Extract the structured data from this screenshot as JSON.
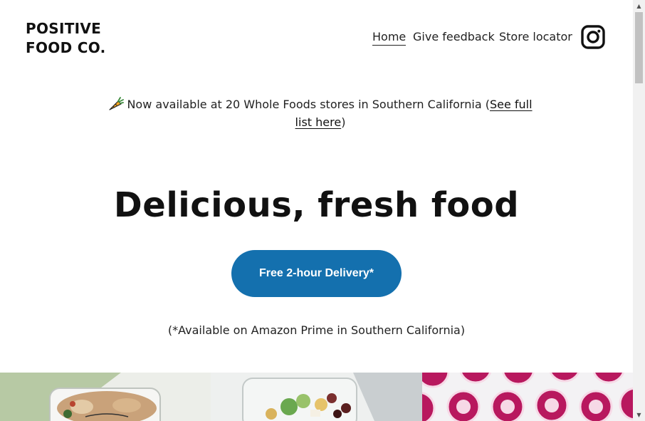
{
  "header": {
    "logo_line1": "POSITIVE",
    "logo_line2": "FOOD CO.",
    "nav": [
      {
        "label": "Home",
        "active": true
      },
      {
        "label": "Give feedback"
      },
      {
        "label": "Store locator"
      }
    ],
    "social_icon": "instagram-icon"
  },
  "announcement": {
    "icon": "carrot-icon",
    "text": "Now available at 20 Whole Foods stores in Southern California (",
    "link": "See full list here",
    "suffix": ")"
  },
  "hero": {
    "title": "Delicious, fresh food",
    "cta_label": "Free 2-hour Delivery*",
    "note": "(*Available on Amazon Prime in Southern California)"
  },
  "colors": {
    "accent": "#1470ae",
    "text": "#111111"
  },
  "scrollbar": {
    "up_icon": "scroll-up-arrow",
    "down_icon": "scroll-down-arrow"
  }
}
